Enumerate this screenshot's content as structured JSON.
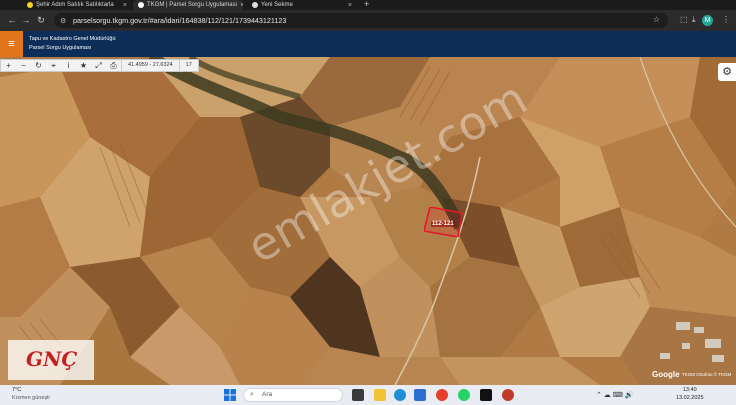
{
  "browser": {
    "tabs": [
      {
        "title": "Şehir Adım Satılık Satılıktarla",
        "active": false
      },
      {
        "title": "TKGM | Parsel Sorgu Uygulaması",
        "active": true
      },
      {
        "title": "Yeni Sekme",
        "active": false
      }
    ],
    "url": "parselsorgu.tkgm.gov.tr/#ara/idari/164838/112/121/1739443121123",
    "profile_initial": "M"
  },
  "app": {
    "org_name": "Tapu ve Kadastro Genel Müdürlüğü",
    "app_name": "Parsel Sorgu Uygulaması"
  },
  "map": {
    "toolbar": {
      "icons": [
        "zoom-in-icon",
        "zoom-out-icon",
        "refresh-icon",
        "locate-icon",
        "info-icon",
        "star-icon",
        "measure-icon",
        "print-icon"
      ],
      "coordinates": "41.4959 - 27.6324",
      "zoom": "17"
    },
    "parcel_label": "112-121",
    "watermark": "emlakjet.com",
    "logo_text": "GNÇ",
    "google_logo": "Google",
    "attribution": "TKGM Ortofoto © TKGM"
  },
  "taskbar": {
    "weather_temp": "7°C",
    "weather_desc": "Kısmen güneşli",
    "search_placeholder": "Ara",
    "time": "13:40",
    "date": "13.02.2025"
  },
  "colors": {
    "header_bg": "#0c2d57",
    "menu_accent": "#e2761d",
    "parcel_outline": "#e5172b"
  }
}
